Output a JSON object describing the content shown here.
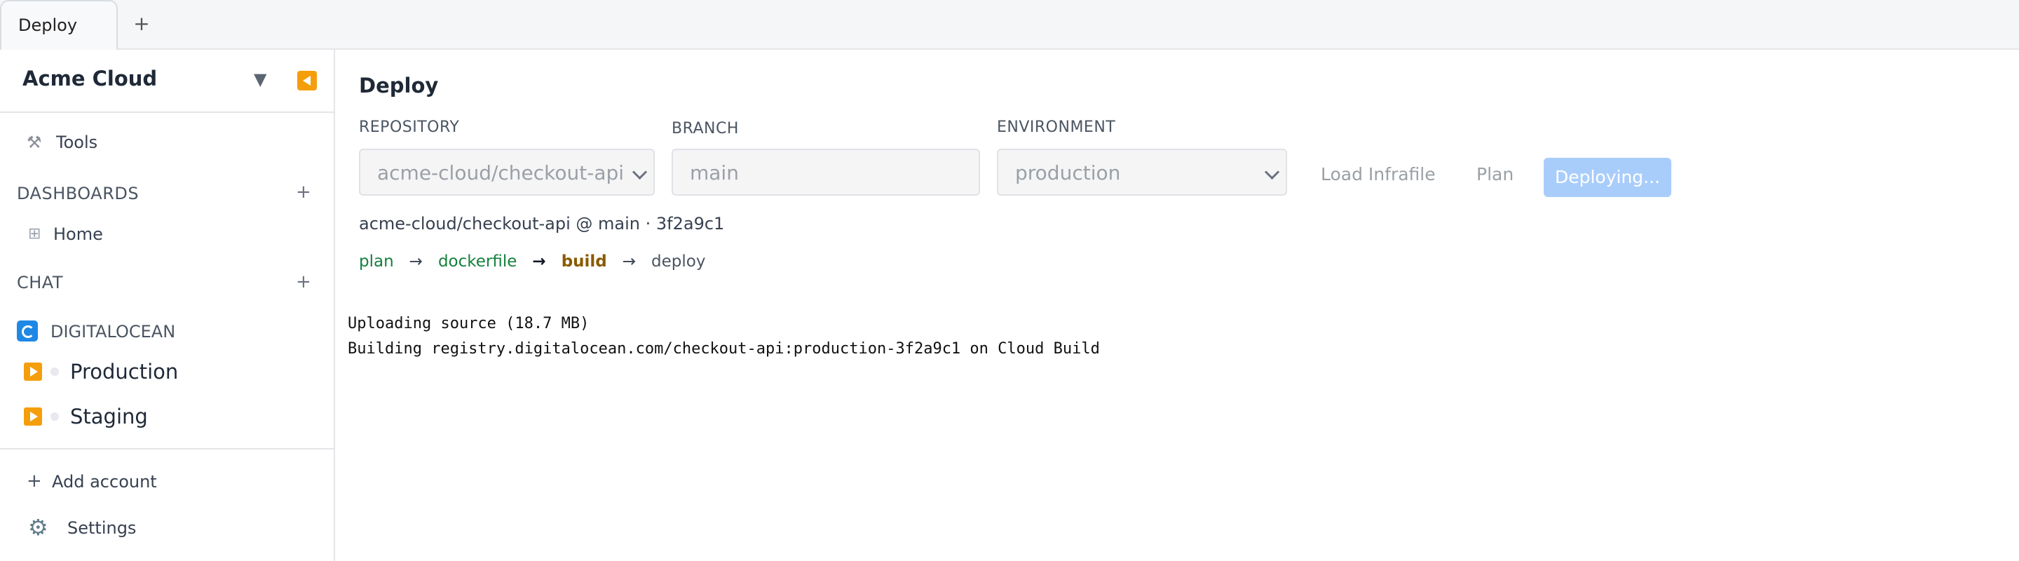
{
  "tabs": [
    {
      "label": "Deploy"
    }
  ],
  "new_tab_label": "+",
  "sidebar": {
    "brand": "Acme Cloud",
    "tools_label": "Tools",
    "dashboards": {
      "title": "DASHBOARDS",
      "add": "+",
      "items": [
        {
          "label": "Home"
        }
      ]
    },
    "chat": {
      "title": "CHAT",
      "add": "+"
    },
    "provider": {
      "label": "DIGITALOCEAN",
      "accounts": [
        {
          "label": "Production"
        },
        {
          "label": "Staging"
        }
      ]
    },
    "add_account_label": "Add account",
    "settings_label": "Settings"
  },
  "main": {
    "title": "Deploy",
    "repository": {
      "label": "REPOSITORY",
      "value": "acme-cloud/checkout-api"
    },
    "branch": {
      "label": "BRANCH",
      "placeholder": "main"
    },
    "environment": {
      "label": "ENVIRONMENT",
      "value": "production"
    },
    "load_infrafile_label": "Load Infrafile",
    "plan_label": "Plan",
    "deploy_label": "Deploying...",
    "commit_line": "acme-cloud/checkout-api @ main · 3f2a9c1",
    "pipeline": {
      "steps": [
        {
          "label": "plan",
          "state": "done"
        },
        {
          "label": "dockerfile",
          "state": "done"
        },
        {
          "label": "build",
          "state": "active"
        },
        {
          "label": "deploy",
          "state": "pending"
        }
      ],
      "arrow": "→"
    },
    "log_lines": [
      "Uploading source (18.7 MB)",
      "Building registry.digitalocean.com/checkout-api:production-3f2a9c1 on Cloud Build"
    ]
  },
  "colors": {
    "accent": "#f59e0b",
    "primary_disabled": "#a9cdfb",
    "done": "#15803d",
    "active": "#8a5a00",
    "digitalocean": "#1e88e5"
  }
}
